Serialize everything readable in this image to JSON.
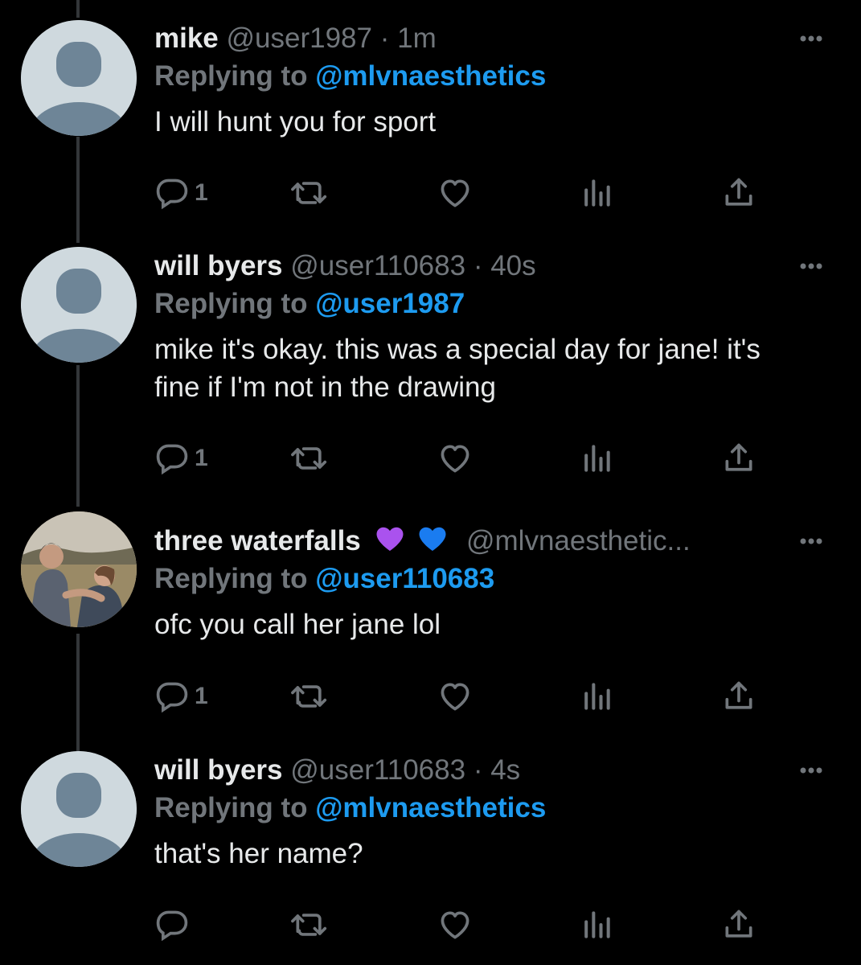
{
  "tweets": [
    {
      "name": "mike",
      "handle": "@user1987",
      "separator": "·",
      "time": "1m",
      "replying_prefix": "Replying to ",
      "replying_to": "@mlvnaesthetics",
      "text": "I will hunt you for sport",
      "reply_count": "1",
      "avatar": "default-avatar",
      "emojis": []
    },
    {
      "name": "will byers",
      "handle": "@user110683",
      "separator": "·",
      "time": "40s",
      "replying_prefix": "Replying to ",
      "replying_to": "@user1987",
      "text": "mike it's okay. this was a special day for jane! it's fine if I'm not in the drawing",
      "reply_count": "1",
      "avatar": "default-avatar",
      "emojis": []
    },
    {
      "name": "three waterfalls",
      "handle": "@mlvnaesthetic...",
      "separator": "",
      "time": "",
      "replying_prefix": "Replying to ",
      "replying_to": "@user110683",
      "text": "ofc you call her jane lol",
      "reply_count": "1",
      "avatar": "photo-avatar",
      "emojis": [
        "purple-heart",
        "blue-heart"
      ]
    },
    {
      "name": "will byers",
      "handle": "@user110683",
      "separator": "·",
      "time": "4s",
      "replying_prefix": "Replying to ",
      "replying_to": "@mlvnaesthetics",
      "text": "that's her name?",
      "reply_count": "",
      "avatar": "default-avatar",
      "emojis": []
    }
  ],
  "colors": {
    "background": "#000000",
    "text": "#e7e9ea",
    "muted": "#71767b",
    "accent": "#1d9bf0",
    "avatar_bg": "#cfd9de",
    "avatar_fg": "#6e8597"
  },
  "icons": {
    "reply": "reply-icon",
    "retweet": "retweet-icon",
    "like": "heart-icon",
    "views": "analytics-icon",
    "share": "share-icon",
    "more": "more-icon"
  }
}
